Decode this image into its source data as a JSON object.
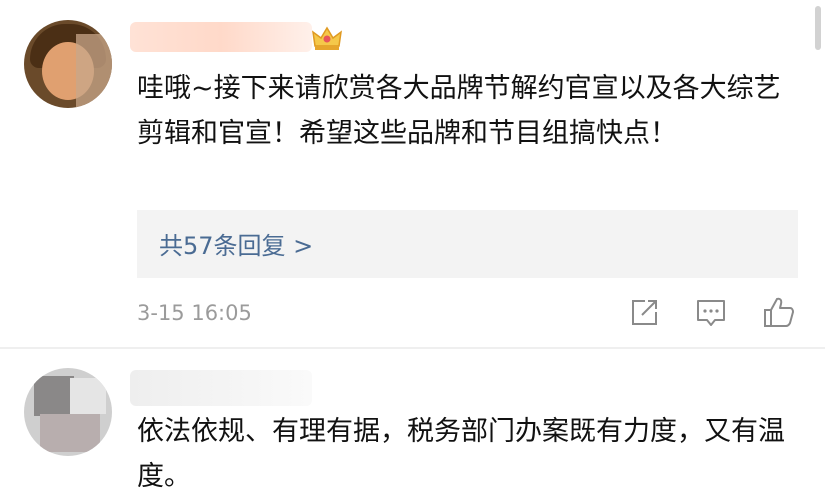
{
  "comment_1": {
    "text": "哇哦~接下来请欣赏各大品牌节解约官宣以及各大综艺剪辑和官宣！希望这些品牌和节目组搞快点！",
    "replies_label": "共57条回复 >",
    "timestamp": "3-15 16:05",
    "badge_icon": "crown-icon"
  },
  "comment_2": {
    "text": "依法依规、有理有据，税务部门办案既有力度，又有温度。"
  },
  "actions": [
    "share-icon",
    "reply-icon",
    "like-icon"
  ]
}
